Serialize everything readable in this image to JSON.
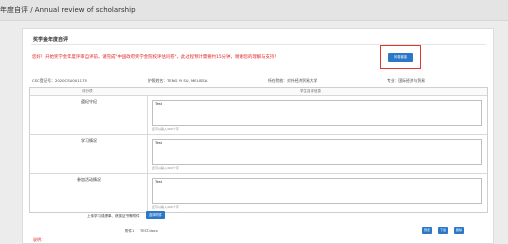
{
  "header": {
    "breadcrumb": "年度自评 / Annual review of scholarship"
  },
  "section": {
    "title": "奖学金年度自评"
  },
  "notice": "您好！开始奖学金年度评审自评前，请完成\"中国政府奖学金院校评估问卷\"，此过程预计需要约15分钟，谢谢您的理解与支持！",
  "questionnaire_button": "问卷链接",
  "info": {
    "csc_no": "CSC登记号：2020CSU001175",
    "name": "护照姓名：TENG YI SU, MELISSA",
    "university": "所在院校：对外经济贸易大学",
    "major": "专业：国际经济与贸易"
  },
  "table": {
    "header_left": "评分项",
    "header_right": "学生自评信息",
    "rows": [
      {
        "label": "遵纪守纪",
        "value": "Test",
        "hint": "还可以输入499个字"
      },
      {
        "label": "学习情况",
        "value": "Test",
        "hint": "还可以输入499个字"
      },
      {
        "label": "参加活动情况",
        "value": "Test",
        "hint": "还可以输入499个字"
      }
    ]
  },
  "upload": {
    "label": "上传学习成绩单、获奖证书等附件",
    "button": "选择附件"
  },
  "attachment": {
    "label": "附件1",
    "filename": "TEST.docx",
    "actions": [
      "预览",
      "下载",
      "删除"
    ]
  },
  "footnote": "说明："
}
